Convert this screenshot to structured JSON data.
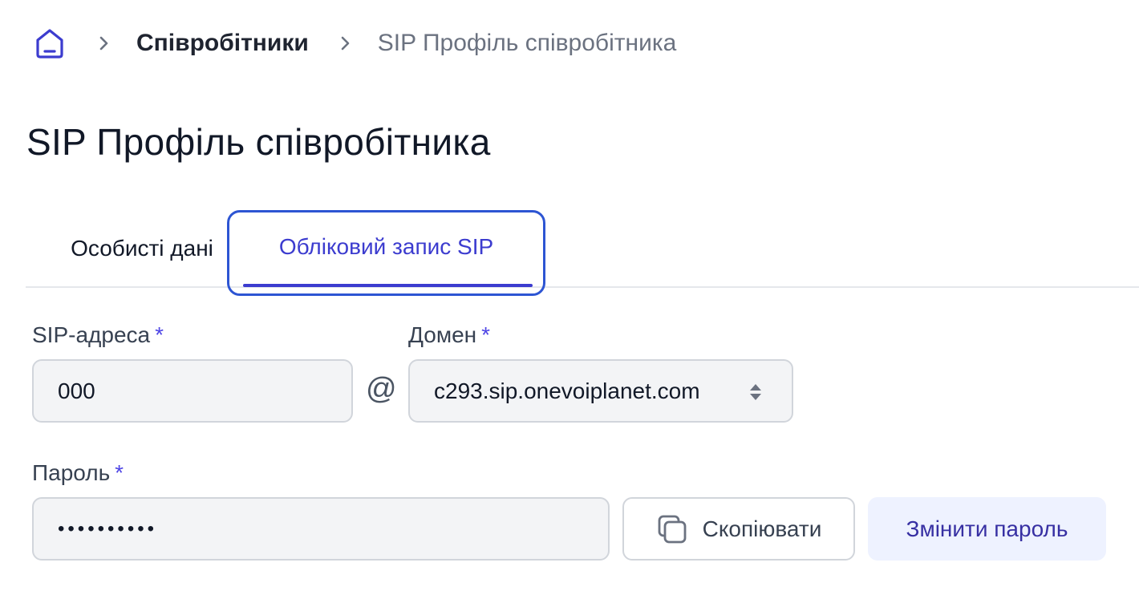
{
  "breadcrumb": {
    "home_icon": "home-icon",
    "separator_icon": "chevron-right-icon",
    "parent_label": "Співробітники",
    "current_label": "SIP Профіль співробітника"
  },
  "page": {
    "title": "SIP Профіль співробітника"
  },
  "tabs": [
    {
      "label": "Особисті дані",
      "active": false
    },
    {
      "label": "Обліковий запис SIP",
      "active": true
    }
  ],
  "form": {
    "sip_address": {
      "label": "SIP-адреса",
      "required_mark": "*",
      "value": "000"
    },
    "at_sign": "@",
    "domain": {
      "label": "Домен",
      "required_mark": "*",
      "selected": "c293.sip.onevoiplanet.com"
    },
    "password": {
      "label": "Пароль",
      "required_mark": "*",
      "masked_value": "••••••••••"
    }
  },
  "buttons": {
    "copy_label": "Скопіювати",
    "copy_icon": "copy-icon",
    "change_password_label": "Змінити пароль"
  },
  "colors": {
    "accent": "#3c3ccf",
    "focus_ring": "#2d55d3",
    "input_bg": "#f3f4f6",
    "secondary_button_bg": "#eef2ff"
  }
}
